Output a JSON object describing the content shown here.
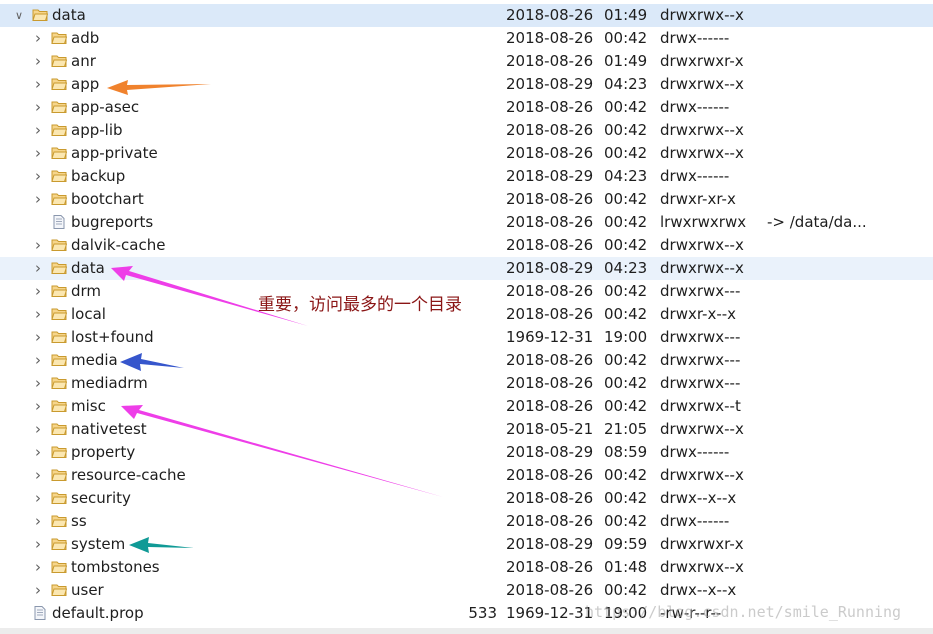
{
  "tree": {
    "rows": [
      {
        "name": "data",
        "date": "2018-08-26",
        "time": "01:49",
        "perm": "drwxrwx--x",
        "type": "folder",
        "depth": 0,
        "expanded": true,
        "selected": true
      },
      {
        "name": "adb",
        "date": "2018-08-26",
        "time": "00:42",
        "perm": "drwx------",
        "type": "folder",
        "depth": 1
      },
      {
        "name": "anr",
        "date": "2018-08-26",
        "time": "01:49",
        "perm": "drwxrwxr-x",
        "type": "folder",
        "depth": 1
      },
      {
        "name": "app",
        "date": "2018-08-29",
        "time": "04:23",
        "perm": "drwxrwx--x",
        "type": "folder",
        "depth": 1
      },
      {
        "name": "app-asec",
        "date": "2018-08-26",
        "time": "00:42",
        "perm": "drwx------",
        "type": "folder",
        "depth": 1
      },
      {
        "name": "app-lib",
        "date": "2018-08-26",
        "time": "00:42",
        "perm": "drwxrwx--x",
        "type": "folder",
        "depth": 1
      },
      {
        "name": "app-private",
        "date": "2018-08-26",
        "time": "00:42",
        "perm": "drwxrwx--x",
        "type": "folder",
        "depth": 1
      },
      {
        "name": "backup",
        "date": "2018-08-29",
        "time": "04:23",
        "perm": "drwx------",
        "type": "folder",
        "depth": 1
      },
      {
        "name": "bootchart",
        "date": "2018-08-26",
        "time": "00:42",
        "perm": "drwxr-xr-x",
        "type": "folder",
        "depth": 1
      },
      {
        "name": "bugreports",
        "date": "2018-08-26",
        "time": "00:42",
        "perm": "lrwxrwxrwx",
        "info": "-> /data/da...",
        "type": "file",
        "depth": 1
      },
      {
        "name": "dalvik-cache",
        "date": "2018-08-26",
        "time": "00:42",
        "perm": "drwxrwx--x",
        "type": "folder",
        "depth": 1
      },
      {
        "name": "data",
        "date": "2018-08-29",
        "time": "04:23",
        "perm": "drwxrwx--x",
        "type": "folder",
        "depth": 1,
        "hover": true
      },
      {
        "name": "drm",
        "date": "2018-08-26",
        "time": "00:42",
        "perm": "drwxrwx---",
        "type": "folder",
        "depth": 1
      },
      {
        "name": "local",
        "date": "2018-08-26",
        "time": "00:42",
        "perm": "drwxr-x--x",
        "type": "folder",
        "depth": 1
      },
      {
        "name": "lost+found",
        "date": "1969-12-31",
        "time": "19:00",
        "perm": "drwxrwx---",
        "type": "folder",
        "depth": 1
      },
      {
        "name": "media",
        "date": "2018-08-26",
        "time": "00:42",
        "perm": "drwxrwx---",
        "type": "folder",
        "depth": 1
      },
      {
        "name": "mediadrm",
        "date": "2018-08-26",
        "time": "00:42",
        "perm": "drwxrwx---",
        "type": "folder",
        "depth": 1
      },
      {
        "name": "misc",
        "date": "2018-08-26",
        "time": "00:42",
        "perm": "drwxrwx--t",
        "type": "folder",
        "depth": 1
      },
      {
        "name": "nativetest",
        "date": "2018-05-21",
        "time": "21:05",
        "perm": "drwxrwx--x",
        "type": "folder",
        "depth": 1
      },
      {
        "name": "property",
        "date": "2018-08-29",
        "time": "08:59",
        "perm": "drwx------",
        "type": "folder",
        "depth": 1
      },
      {
        "name": "resource-cache",
        "date": "2018-08-26",
        "time": "00:42",
        "perm": "drwxrwx--x",
        "type": "folder",
        "depth": 1
      },
      {
        "name": "security",
        "date": "2018-08-26",
        "time": "00:42",
        "perm": "drwx--x--x",
        "type": "folder",
        "depth": 1
      },
      {
        "name": "ss",
        "date": "2018-08-26",
        "time": "00:42",
        "perm": "drwx------",
        "type": "folder",
        "depth": 1
      },
      {
        "name": "system",
        "date": "2018-08-29",
        "time": "09:59",
        "perm": "drwxrwxr-x",
        "type": "folder",
        "depth": 1
      },
      {
        "name": "tombstones",
        "date": "2018-08-26",
        "time": "01:48",
        "perm": "drwxrwx--x",
        "type": "folder",
        "depth": 1
      },
      {
        "name": "user",
        "date": "2018-08-26",
        "time": "00:42",
        "perm": "drwx--x--x",
        "type": "folder",
        "depth": 1
      },
      {
        "name": "default.prop",
        "size": "533",
        "date": "1969-12-31",
        "time": "19:00",
        "perm": "-rw-r--r--",
        "type": "file",
        "depth": 0
      }
    ]
  },
  "annotations": {
    "note": "重要，访问最多的一个目录",
    "arrows": [
      {
        "target": "app",
        "color": "#f0822d"
      },
      {
        "target": "data",
        "color": "#ee3ee8"
      },
      {
        "target": "media",
        "color": "#3656cc"
      },
      {
        "target": "misc",
        "color": "#ee3ee8"
      },
      {
        "target": "system",
        "color": "#109a96"
      }
    ]
  },
  "watermark": "https://blog.csdn.net/smile_Running",
  "colors": {
    "selected_row": "#dbe9f9",
    "hover_row": "#eaf2fb",
    "folder_fill": "#f6d58b",
    "folder_stroke": "#c99a2e"
  },
  "icons": {
    "expander_open": "chevron-down-icon",
    "expander_closed": "chevron-right-icon",
    "folder": "folder-icon",
    "file": "file-icon"
  }
}
